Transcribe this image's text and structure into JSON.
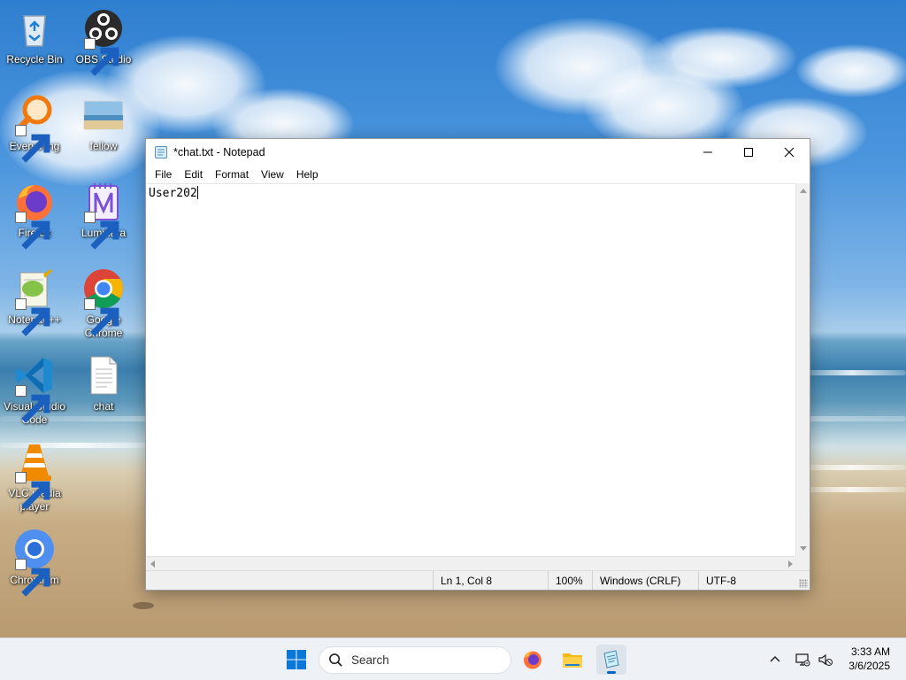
{
  "desktop": {
    "icons": [
      {
        "label": "Recycle Bin",
        "icon": "recycle-bin-icon"
      },
      {
        "label": "OBS Studio",
        "icon": "obs-icon"
      },
      {
        "label": "Everything",
        "icon": "everything-search-icon"
      },
      {
        "label": "fellow",
        "icon": "image-file-icon"
      },
      {
        "label": "Firefox",
        "icon": "firefox-icon"
      },
      {
        "label": "Luminara",
        "icon": "luminara-icon"
      },
      {
        "label": "Notepad++",
        "icon": "notepad-plus-plus-icon"
      },
      {
        "label": "Google Chrome",
        "icon": "chrome-icon"
      },
      {
        "label": "Visual Studio Code",
        "icon": "vscode-icon"
      },
      {
        "label": "chat",
        "icon": "text-file-icon"
      },
      {
        "label": "VLC media player",
        "icon": "vlc-icon"
      },
      {
        "label": "Chromium",
        "icon": "chromium-icon"
      }
    ]
  },
  "notepad": {
    "title": "*chat.txt - Notepad",
    "menu": [
      "File",
      "Edit",
      "Format",
      "View",
      "Help"
    ],
    "content": "User202",
    "status": {
      "position": "Ln 1, Col 8",
      "zoom": "100%",
      "line_ending": "Windows (CRLF)",
      "encoding": "UTF-8"
    }
  },
  "taskbar": {
    "search_placeholder": "Search",
    "pinned": [
      "start-icon",
      "search-icon",
      "firefox-icon",
      "file-explorer-icon",
      "notepad-icon"
    ],
    "active": "notepad-icon",
    "time": "3:33 AM",
    "date": "3/6/2025"
  },
  "colors": {
    "accent": "#0067c0",
    "taskbar": "#eef1f5",
    "status_bar": "#f0f0f0"
  }
}
